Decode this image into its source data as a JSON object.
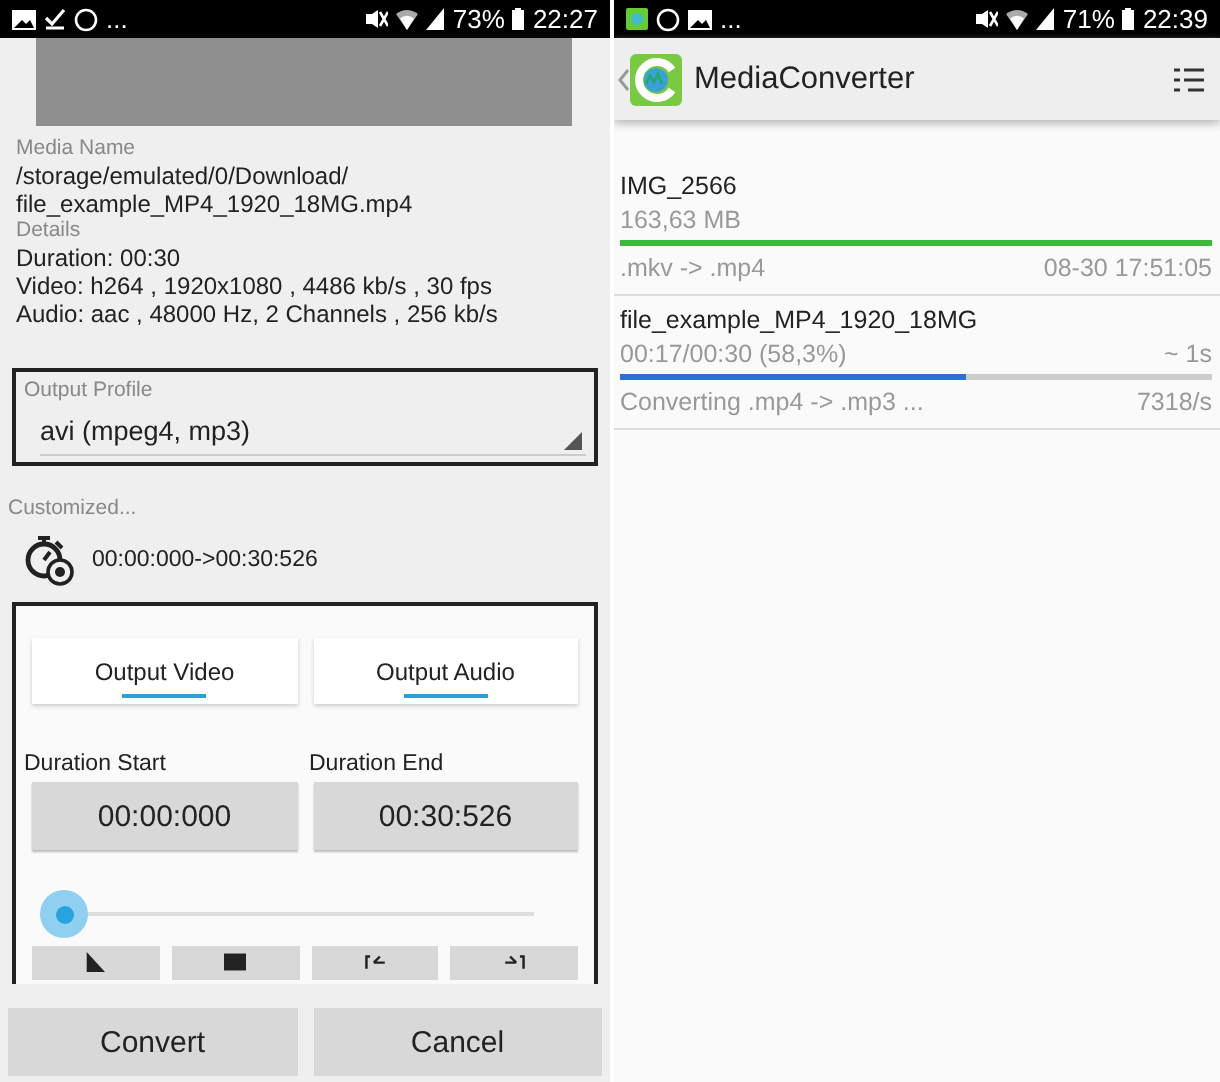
{
  "left_screen": {
    "status_bar": {
      "overflow": "...",
      "battery": "73%",
      "time": "22:27"
    },
    "media_name": {
      "label": "Media Name",
      "lines": [
        "/storage/emulated/0/Download/",
        "file_example_MP4_1920_18MG.mp4"
      ]
    },
    "details": {
      "label": "Details",
      "lines": [
        "Duration: 00:30",
        "Video: h264 , 1920x1080 , 4486 kb/s , 30 fps",
        "Audio: aac , 48000 Hz, 2 Channels , 256 kb/s"
      ]
    },
    "output_profile": {
      "label": "Output Profile",
      "value": "avi (mpeg4, mp3)"
    },
    "customized_label": "Customized...",
    "range": "00:00:000->00:30:526",
    "tabs": [
      "Output Video",
      "Output Audio"
    ],
    "duration_start": {
      "label": "Duration Start",
      "value": "00:00:000"
    },
    "duration_end": {
      "label": "Duration End",
      "value": "00:30:526"
    },
    "slider": {
      "level": 0
    },
    "media_buttons": [
      {
        "kind": "play"
      },
      {
        "kind": "stop"
      },
      {
        "kind": "mark_start"
      },
      {
        "kind": "mark_end"
      }
    ],
    "buttons": [
      "Convert",
      "Cancel"
    ]
  },
  "right_screen": {
    "status_bar": {
      "overflow": "...",
      "battery": "71%",
      "time": "22:39"
    },
    "app_title": "MediaConverter",
    "tasks": [
      {
        "name": "IMG_2566",
        "status": "163,63 MB",
        "level": 1,
        "color": "#3cb83c",
        "conversion": ".mkv -> .mp4",
        "info": "08-30 17:51:05"
      },
      {
        "name": "file_example_MP4_1920_18MG",
        "status": "00:17/00:30 (58,3%)",
        "remaining": "~ 1s",
        "level": 0.583,
        "color": "#2f6fd8",
        "conversion": "Converting .mp4 -> .mp3 ...",
        "info": "7318/s"
      }
    ]
  }
}
